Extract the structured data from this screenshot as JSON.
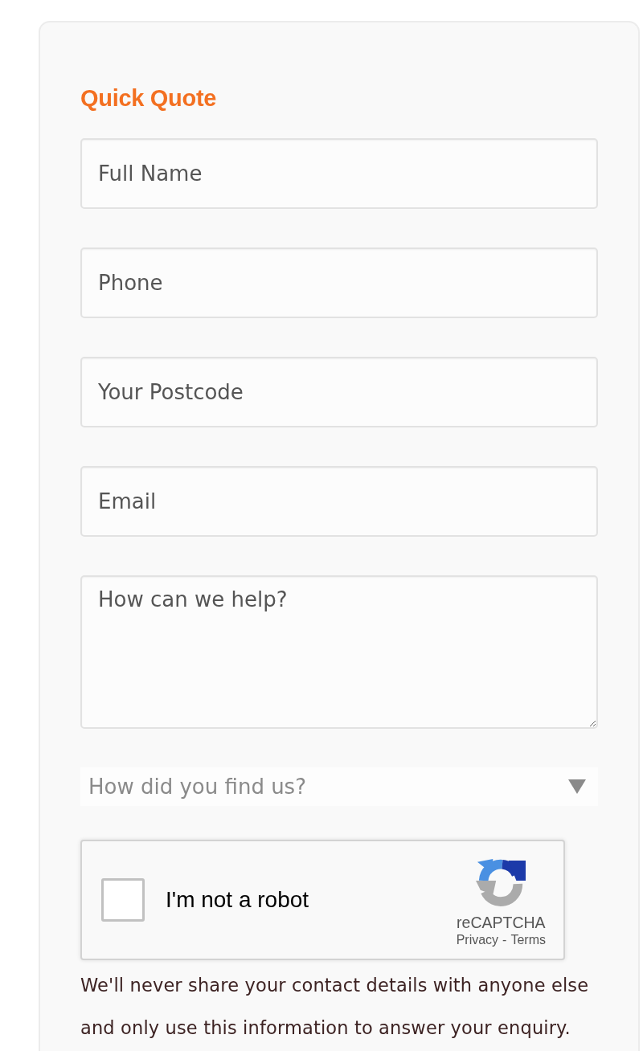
{
  "form": {
    "title": "Quick Quote",
    "fields": [
      {
        "kind": "input",
        "placeholder": "Full Name"
      },
      {
        "kind": "input",
        "placeholder": "Phone"
      },
      {
        "kind": "input",
        "placeholder": "Your Postcode"
      },
      {
        "kind": "input",
        "placeholder": "Email"
      },
      {
        "kind": "textarea",
        "placeholder": "How can we help?"
      },
      {
        "kind": "select",
        "placeholder": "How did you find us?"
      }
    ],
    "captcha": {
      "checked": false,
      "label": "I'm not a robot",
      "brand": "reCAPTCHA",
      "links": [
        {
          "label": "Privacy"
        },
        {
          "label": "Terms"
        }
      ],
      "separator": "-"
    },
    "note": "We'll never share your contact details with anyone else and only use this information to answer your enquiry."
  }
}
